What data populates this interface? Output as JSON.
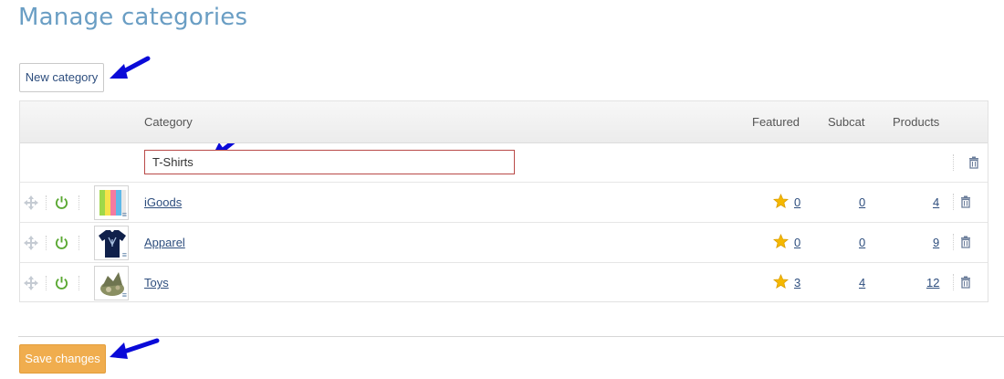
{
  "page": {
    "title": "Manage categories"
  },
  "toolbar": {
    "new_category_label": "New category"
  },
  "table": {
    "headers": {
      "category": "Category",
      "featured": "Featured",
      "subcat": "Subcat",
      "products": "Products"
    },
    "new_row": {
      "input_value": "T-Shirts"
    },
    "rows": [
      {
        "name": "iGoods",
        "featured": "0",
        "subcat": "0",
        "products": "4",
        "thumb_icon": "phones-thumbnail"
      },
      {
        "name": "Apparel",
        "featured": "0",
        "subcat": "0",
        "products": "9",
        "thumb_icon": "tshirt-thumbnail"
      },
      {
        "name": "Toys",
        "featured": "3",
        "subcat": "4",
        "products": "12",
        "thumb_icon": "toy-thumbnail"
      }
    ]
  },
  "footer": {
    "save_label": "Save changes"
  },
  "colors": {
    "title": "#6a9ec4",
    "link": "#2e4e7e",
    "save_button": "#f0ad4e",
    "enabled_icon": "#5aa832",
    "star": "#f5b800",
    "arrow": "#1010e0",
    "input_error_border": "#b94a48"
  }
}
